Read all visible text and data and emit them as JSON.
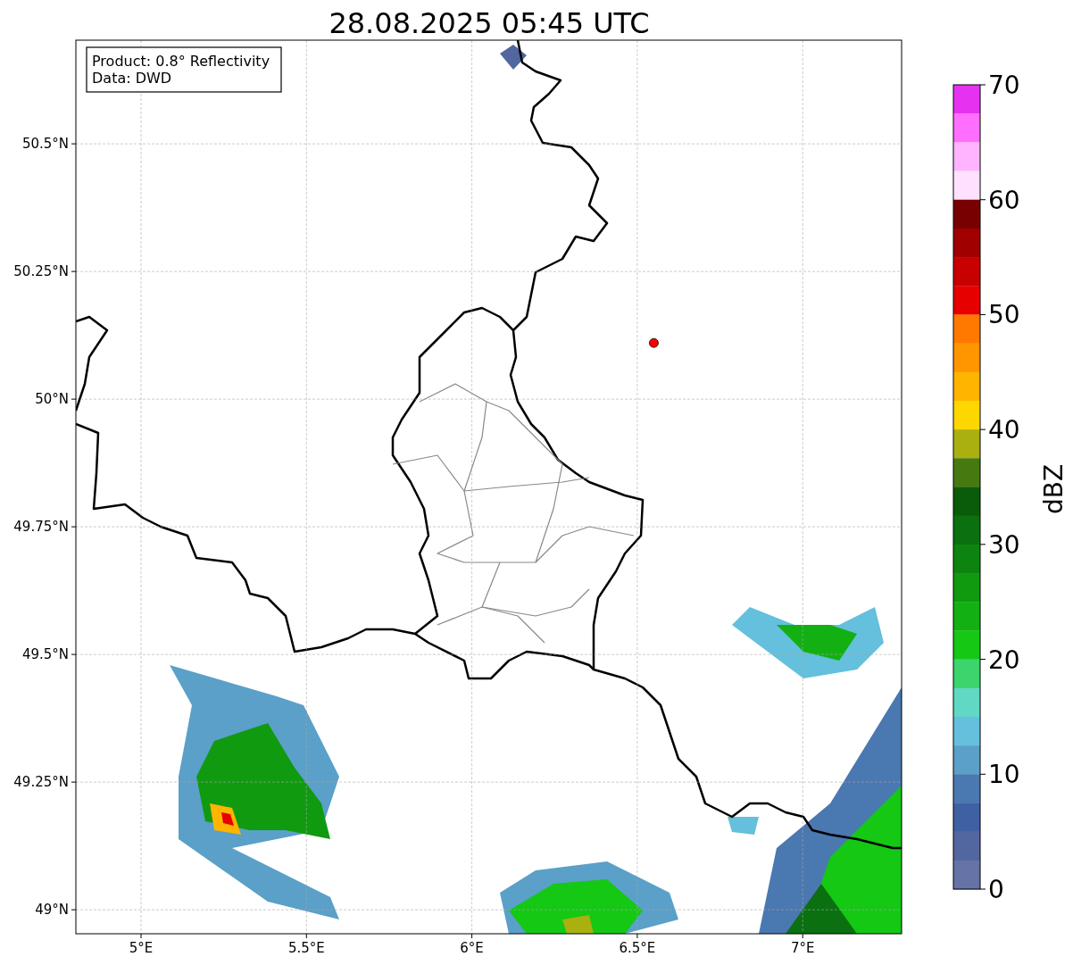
{
  "figure": {
    "chart_data": {
      "type": "scatter",
      "title": "28.08.2025 05:45 UTC",
      "xlim": [
        4.803,
        7.299
      ],
      "ylim": [
        48.953,
        50.703
      ],
      "xticks": [
        {
          "value": 5,
          "label": "5°E"
        },
        {
          "value": 5.5,
          "label": "5.5°E"
        },
        {
          "value": 6,
          "label": "6°E"
        },
        {
          "value": 6.5,
          "label": "6.5°E"
        },
        {
          "value": 7,
          "label": "7°E"
        }
      ],
      "yticks": [
        {
          "value": 50.5,
          "label": "50.5°N"
        },
        {
          "value": 50.25,
          "label": "50.25°N"
        },
        {
          "value": 50,
          "label": "50°N"
        },
        {
          "value": 49.75,
          "label": "49.75°N"
        },
        {
          "value": 49.5,
          "label": "49.5°N"
        },
        {
          "value": 49.25,
          "label": "49.25°N"
        },
        {
          "value": 49,
          "label": "49°N"
        }
      ],
      "x": [
        6.55
      ],
      "series": [
        {
          "color": "#ff0000",
          "values": [
            50.11
          ]
        }
      ],
      "grid": true
    },
    "legend": [
      "Product: 0.8° Reflectivity",
      "Data: DWD"
    ],
    "colorbar": {
      "label": "dBZ",
      "ticks": [
        "70",
        "60",
        "50",
        "40",
        "30",
        "20",
        "10",
        "0"
      ],
      "bands": [
        {
          "color": "#e632f0"
        },
        {
          "color": "#ff6eff"
        },
        {
          "color": "#ffb4ff"
        },
        {
          "color": "#ffe0ff"
        },
        {
          "color": "#780000"
        },
        {
          "color": "#a00000"
        },
        {
          "color": "#c80000"
        },
        {
          "color": "#e60000"
        },
        {
          "color": "#ff7800"
        },
        {
          "color": "#ff9600"
        },
        {
          "color": "#ffb400"
        },
        {
          "color": "#ffd700"
        },
        {
          "color": "#aab010"
        },
        {
          "color": "#467a10"
        },
        {
          "color": "#0a5c0a"
        },
        {
          "color": "#0b7010"
        },
        {
          "color": "#0e8410"
        },
        {
          "color": "#109a10"
        },
        {
          "color": "#12b012"
        },
        {
          "color": "#14c814"
        },
        {
          "color": "#3cd46c"
        },
        {
          "color": "#60d8c4"
        },
        {
          "color": "#64c0dc"
        },
        {
          "color": "#5aa0c8"
        },
        {
          "color": "#4a78b0"
        },
        {
          "color": "#4060a4"
        },
        {
          "color": "#5266a0"
        },
        {
          "color": "#6673a6"
        }
      ]
    }
  }
}
